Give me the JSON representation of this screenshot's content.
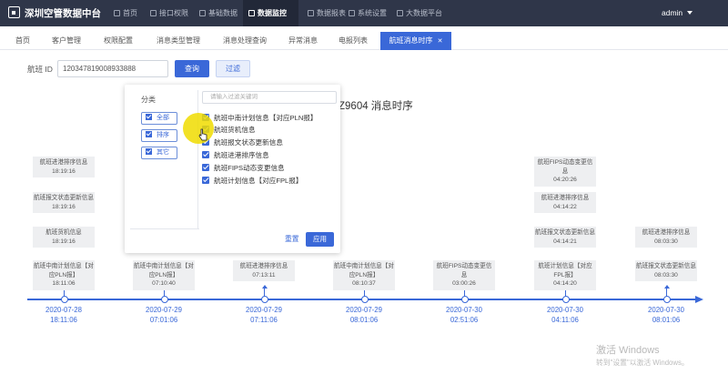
{
  "app": {
    "title": "深圳空管数据中台",
    "user": "admin"
  },
  "nav": [
    {
      "label": "首页",
      "icon": "home-icon"
    },
    {
      "label": "接口权限",
      "icon": "key-icon"
    },
    {
      "label": "基础数据",
      "icon": "database-icon"
    },
    {
      "label": "数据监控",
      "icon": "monitor-icon",
      "active": true
    },
    {
      "label": "数据报表",
      "icon": "report-icon"
    },
    {
      "label": "系统设置",
      "icon": "gear-icon"
    },
    {
      "label": "大数据平台",
      "icon": "bigdata-icon"
    }
  ],
  "tabs": [
    "首页",
    "客户管理",
    "权限配置",
    "消息类型管理",
    "消息处理查询",
    "异常消息",
    "电报列表",
    "航班消息时序"
  ],
  "active_tab": "航班消息时序",
  "search": {
    "label": "航班 ID",
    "value": "120347819008933888",
    "query_button": "查询",
    "filter_button": "过滤"
  },
  "page_title": "Z9604 消息时序",
  "filter_panel": {
    "category_label": "分类",
    "categories": [
      "全部",
      "排序",
      "其它"
    ],
    "search_placeholder": "请输入过滤关键词",
    "items": [
      "航班中南计划信息【对应PLN报】",
      "航班货机信息",
      "航班报文状态更新信息",
      "航班进港排序信息",
      "航班FIPS动态变更信息",
      "航班计划信息【对应FPL报】"
    ],
    "reset": "重置",
    "apply": "应用"
  },
  "timeline": [
    {
      "date": "2020-07-28",
      "time": "18:11:06",
      "cards": [
        {
          "title": "航班中南计划信息【对应PLN报】",
          "time": "18:11:06"
        },
        {
          "title": "航班货机信息",
          "time": "18:19:16"
        },
        {
          "title": "航班报文状态更新信息",
          "time": "18:19:16"
        },
        {
          "title": "航班进港排序信息",
          "time": "18:19:16"
        }
      ]
    },
    {
      "date": "2020-07-29",
      "time": "07:01:06",
      "cards": [
        {
          "title": "航班中南计划信息【对应PLN报】",
          "time": "07:10:40"
        }
      ]
    },
    {
      "date": "2020-07-29",
      "time": "07:11:06",
      "cards": [
        {
          "title": "航班进港排序信息",
          "time": "07:13:11"
        }
      ]
    },
    {
      "date": "2020-07-29",
      "time": "08:01:06",
      "cards": [
        {
          "title": "航班中南计划信息【对应PLN报】",
          "time": "08:10:37"
        }
      ]
    },
    {
      "date": "2020-07-30",
      "time": "02:51:06",
      "cards": [
        {
          "title": "航班FIPS动态变更信息",
          "time": "03:00:26"
        }
      ]
    },
    {
      "date": "2020-07-30",
      "time": "04:11:06",
      "cards": [
        {
          "title": "航班计划信息【对应FPL报】",
          "time": "04:14:20"
        },
        {
          "title": "航班报文状态更新信息",
          "time": "04:14:21"
        },
        {
          "title": "航班进港排序信息",
          "time": "04:14:22"
        },
        {
          "title": "航班FIPS动态变更信息",
          "time": "04:20:26"
        }
      ]
    },
    {
      "date": "2020-07-30",
      "time": "08:01:06",
      "cards": [
        {
          "title": "航班报文状态更新信息",
          "time": "08:03:30"
        },
        {
          "title": "航班进港排序信息",
          "time": "08:03:30"
        }
      ]
    }
  ],
  "watermark": {
    "line1": "激活 Windows",
    "line2": "转到\"设置\"以激活 Windows。"
  }
}
